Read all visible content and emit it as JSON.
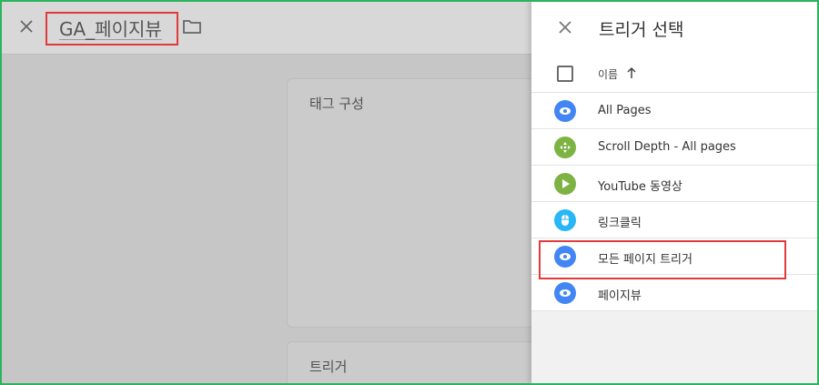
{
  "colors": {
    "frame_border": "#2db35d",
    "highlight": "#e03a3a",
    "pageview_icon": "#4285f4",
    "scroll_icon": "#7cb342",
    "youtube_icon": "#7cb342",
    "click_icon": "#29b6f6"
  },
  "editor": {
    "tag_name": "GA_페이지뷰",
    "config_card_title": "태그 구성",
    "trigger_card_title": "트리거"
  },
  "panel": {
    "title": "트리거 선택",
    "column_header": "이름",
    "triggers": [
      {
        "label": "All Pages",
        "icon": "eye-icon",
        "color": "#4285f4"
      },
      {
        "label": "Scroll Depth - All pages",
        "icon": "move-arrows-icon",
        "color": "#7cb342"
      },
      {
        "label": "YouTube 동영상",
        "icon": "play-icon",
        "color": "#7cb342"
      },
      {
        "label": "링크클릭",
        "icon": "mouse-icon",
        "color": "#29b6f6"
      },
      {
        "label": "모든 페이지 트리거",
        "icon": "eye-icon",
        "color": "#4285f4"
      },
      {
        "label": "페이지뷰",
        "icon": "eye-icon",
        "color": "#4285f4"
      }
    ]
  }
}
